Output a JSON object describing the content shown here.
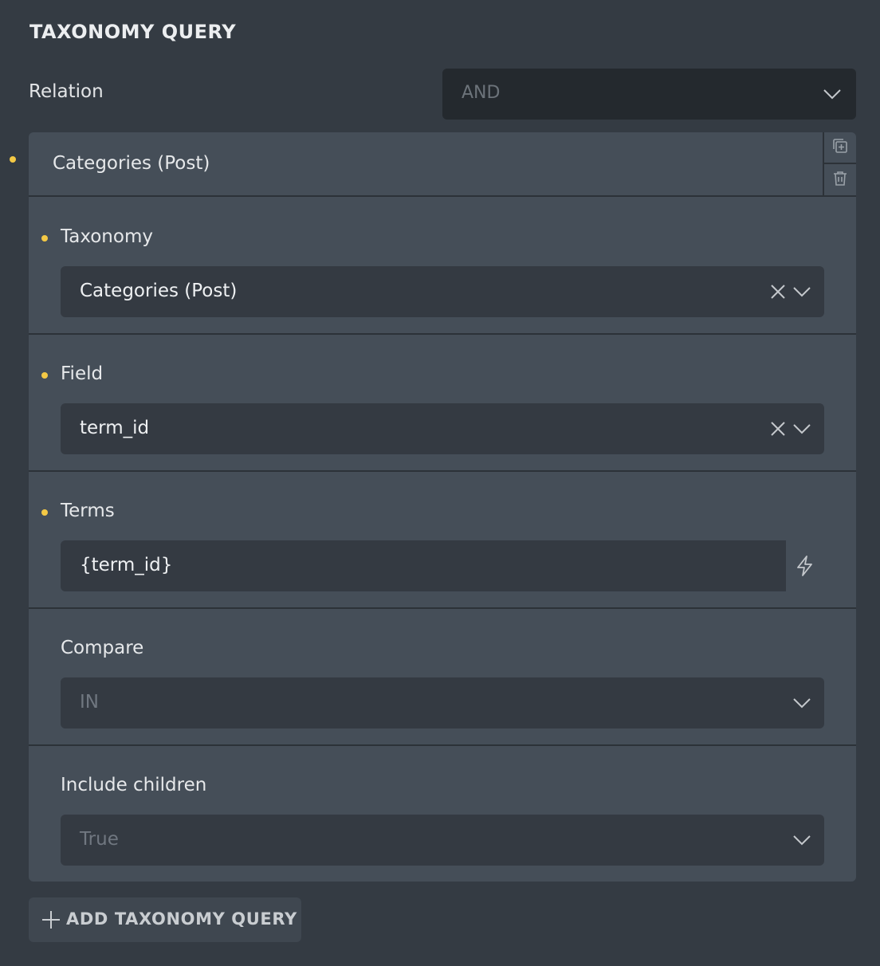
{
  "section": {
    "title": "TAXONOMY QUERY"
  },
  "relation": {
    "label": "Relation",
    "value": "AND"
  },
  "query_item": {
    "title": "Categories (Post)",
    "actions": {
      "duplicate_icon": "copy-plus-icon",
      "delete_icon": "trash-icon"
    },
    "fields": {
      "taxonomy": {
        "label": "Taxonomy",
        "value": "Categories (Post)"
      },
      "field": {
        "label": "Field",
        "value": "term_id"
      },
      "terms": {
        "label": "Terms",
        "value": "{term_id}"
      },
      "compare": {
        "label": "Compare",
        "value": "IN"
      },
      "include_children": {
        "label": "Include children",
        "value": "True"
      }
    }
  },
  "add_button": {
    "label": "ADD TAXONOMY QUERY"
  },
  "colors": {
    "background": "#343b43",
    "card": "#454e58",
    "input": "#343a42",
    "select_dark": "#24292e",
    "indicator_dot": "#f4c945"
  }
}
